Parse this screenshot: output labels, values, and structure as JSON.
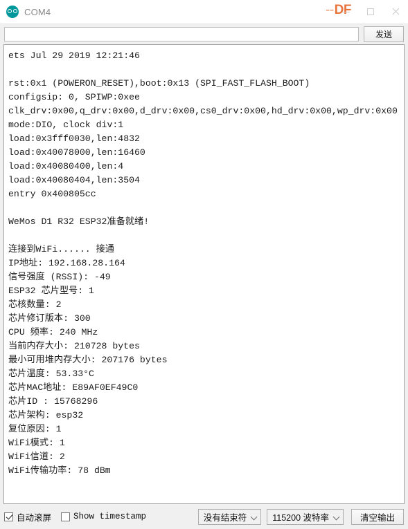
{
  "window": {
    "title": "COM4",
    "app_icon": "arduino-logo-icon",
    "watermark": "DF",
    "watermark_dash": "--",
    "watermark_color": "#e8743b",
    "controls": {
      "minimize": "minimize-icon",
      "maximize": "maximize-icon",
      "close": "close-icon"
    }
  },
  "send_row": {
    "input_value": "",
    "input_placeholder": "",
    "send_label": "发送"
  },
  "console": {
    "lines": [
      "ets Jul 29 2019 12:21:46",
      "",
      "rst:0x1 (POWERON_RESET),boot:0x13 (SPI_FAST_FLASH_BOOT)",
      "configsip: 0, SPIWP:0xee",
      "clk_drv:0x00,q_drv:0x00,d_drv:0x00,cs0_drv:0x00,hd_drv:0x00,wp_drv:0x00",
      "mode:DIO, clock div:1",
      "load:0x3fff0030,len:4832",
      "load:0x40078000,len:16460",
      "load:0x40080400,len:4",
      "load:0x40080404,len:3504",
      "entry 0x400805cc",
      "",
      "WeMos D1 R32 ESP32准备就绪!",
      "",
      "连接到WiFi...... 接通",
      "IP地址: 192.168.28.164",
      "信号强度 (RSSI): -49",
      "ESP32 芯片型号: 1",
      "芯核数量: 2",
      "芯片修订版本: 300",
      "CPU 频率: 240 MHz",
      "当前内存大小: 210728 bytes",
      "最小可用堆内存大小: 207176 bytes",
      "芯片温度: 53.33°C",
      "芯片MAC地址: E89AF0EF49C0",
      "芯片ID : 15768296",
      "芯片架构: esp32",
      "复位原因: 1",
      "WiFi模式: 1",
      "WiFi信道: 2",
      "WiFi传输功率: 78 dBm"
    ]
  },
  "status_bar": {
    "autoscroll_label": "自动滚屏",
    "autoscroll_checked": true,
    "timestamp_label": "Show timestamp",
    "timestamp_checked": false,
    "line_ending_value": "没有结束符",
    "baud_rate_value": "115200 波特率",
    "clear_output_label": "清空输出"
  }
}
